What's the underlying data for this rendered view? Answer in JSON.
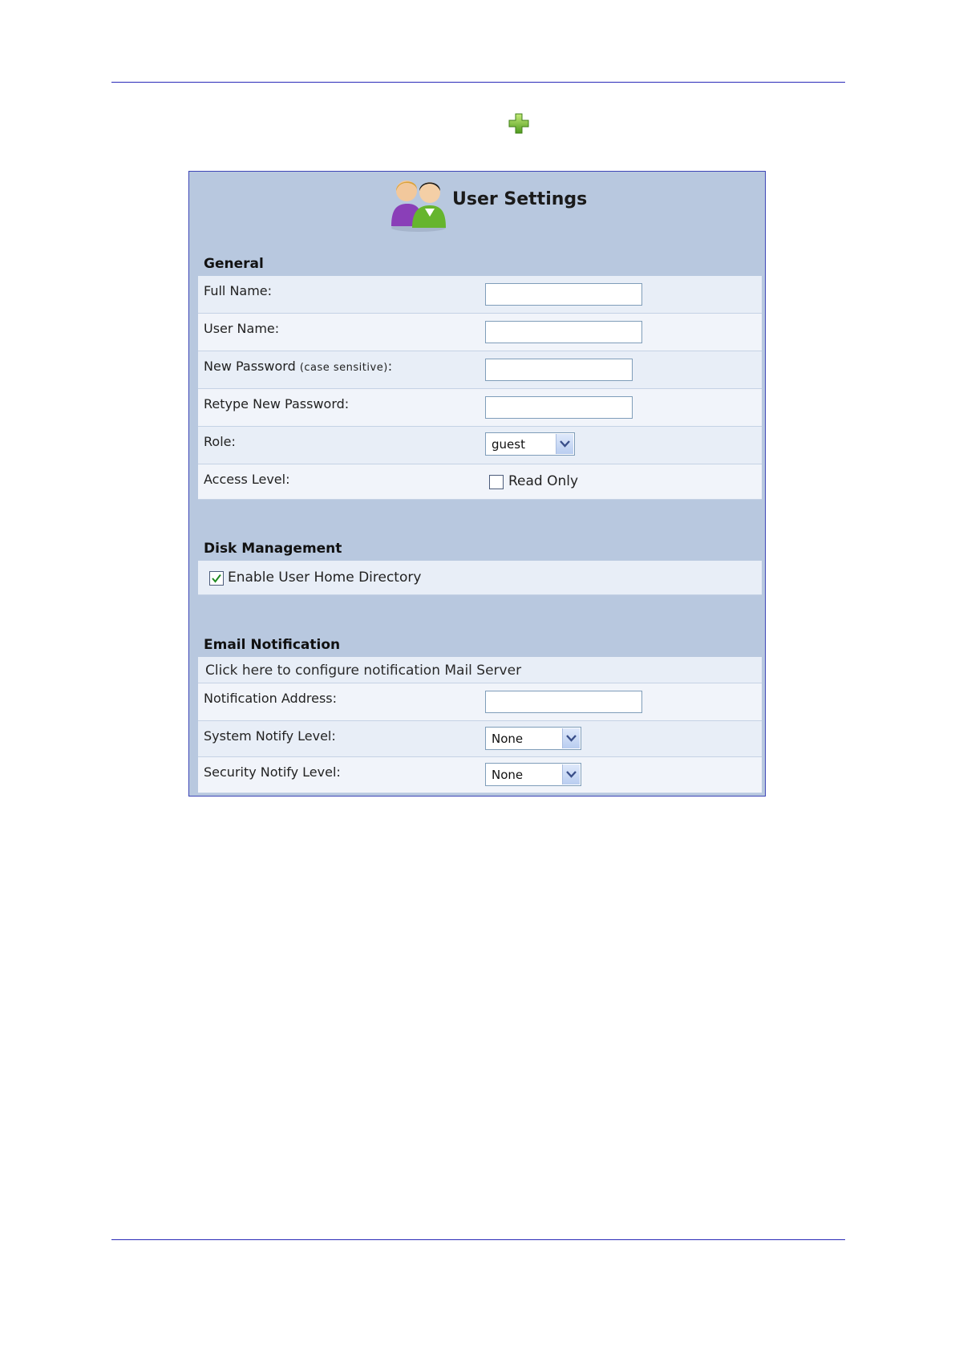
{
  "header": {
    "title": "User Settings",
    "icons": [
      "add-plus-icon",
      "users-icon"
    ]
  },
  "general": {
    "section_title": "General",
    "full_name": {
      "label": "Full Name:",
      "value": ""
    },
    "user_name": {
      "label": "User Name:",
      "value": ""
    },
    "new_password": {
      "label": "New Password",
      "hint": "(case sensitive)",
      "suffix": ":",
      "value": ""
    },
    "retype_password": {
      "label": "Retype New Password:",
      "value": ""
    },
    "role": {
      "label": "Role:",
      "selected": "guest"
    },
    "access_level": {
      "label": "Access Level:",
      "option_label": "Read Only",
      "checked": false
    }
  },
  "disk_management": {
    "section_title": "Disk Management",
    "enable_home_dir": {
      "label": "Enable User Home Directory",
      "checked": true
    }
  },
  "email_notification": {
    "section_title": "Email Notification",
    "configure_link": "Click here to configure notification Mail Server",
    "notification_address": {
      "label": "Notification Address:",
      "value": ""
    },
    "system_notify": {
      "label": "System Notify Level:",
      "selected": "None"
    },
    "security_notify": {
      "label": "Security Notify Level:",
      "selected": "None"
    }
  },
  "colors": {
    "panel_background": "#b8c8df",
    "panel_border": "#3d45b6",
    "rule": "#2a2ab8"
  }
}
